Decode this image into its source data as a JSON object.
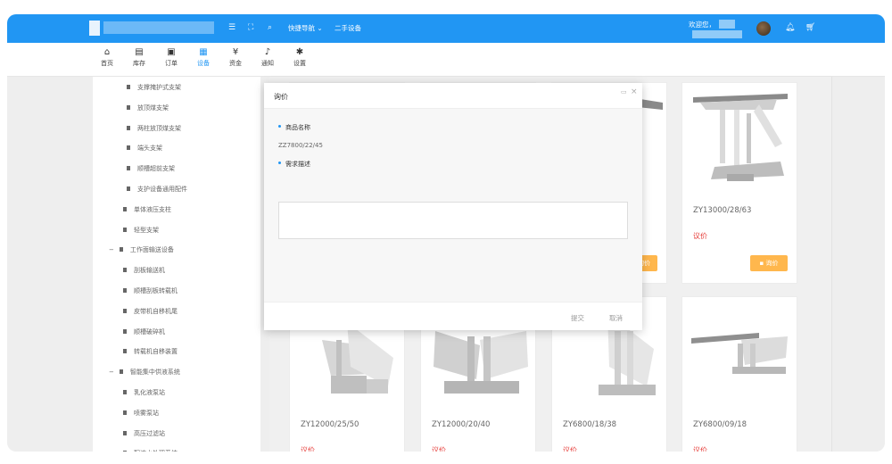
{
  "topbar": {
    "quick_nav": "快捷导航",
    "quick_nav_caret": "⌄",
    "second_hand": "二手设备",
    "welcome": "欢迎您，",
    "icons": [
      "menu-icon",
      "fullscreen-icon",
      "search-icon",
      "bell-icon",
      "cart-icon"
    ],
    "color": "#2196f3"
  },
  "nav": {
    "items": [
      {
        "label": "首页",
        "icon": "home-icon",
        "glyph": "⌂"
      },
      {
        "label": "库存",
        "icon": "inventory-icon",
        "glyph": "▤"
      },
      {
        "label": "订单",
        "icon": "order-icon",
        "glyph": "▣"
      },
      {
        "label": "设备",
        "icon": "equipment-icon",
        "glyph": "▦"
      },
      {
        "label": "资金",
        "icon": "yen-icon",
        "glyph": "¥"
      },
      {
        "label": "通知",
        "icon": "bell-icon",
        "glyph": "♪"
      },
      {
        "label": "设置",
        "icon": "gear-icon",
        "glyph": "✱"
      }
    ],
    "active_index": 3
  },
  "sidebar": {
    "items": [
      {
        "label": "支撑掩护式支架",
        "level": 3
      },
      {
        "label": "放顶煤支架",
        "level": 3
      },
      {
        "label": "两柱放顶煤支架",
        "level": 3
      },
      {
        "label": "端头支架",
        "level": 3
      },
      {
        "label": "顺槽超前支架",
        "level": 3
      },
      {
        "label": "支护设备通用配件",
        "level": 3
      },
      {
        "label": "单体液压支柱",
        "level": 2
      },
      {
        "label": "轻型支架",
        "level": 2
      },
      {
        "label": "工作面输送设备",
        "level": 1,
        "toggle": "−"
      },
      {
        "label": "刮板输送机",
        "level": 2
      },
      {
        "label": "顺槽刮板转载机",
        "level": 2
      },
      {
        "label": "皮带机自移机尾",
        "level": 2
      },
      {
        "label": "顺槽破碎机",
        "level": 2
      },
      {
        "label": "转载机自移装置",
        "level": 2
      },
      {
        "label": "智能集中供液系统",
        "level": 1,
        "toggle": "−"
      },
      {
        "label": "乳化液泵站",
        "level": 2
      },
      {
        "label": "喷雾泵站",
        "level": 2
      },
      {
        "label": "高压过滤站",
        "level": 2
      },
      {
        "label": "配液水处理系统",
        "level": 2
      }
    ]
  },
  "products": {
    "row1": [
      {
        "model": "ZY13000/28/63",
        "price": "议价",
        "ask": "询价"
      }
    ],
    "row1_hidden_ask": "询价",
    "row2": [
      {
        "model": "ZY12000/25/50",
        "price": "议价"
      },
      {
        "model": "ZY12000/20/40",
        "price": "议价"
      },
      {
        "model": "ZY6800/18/38",
        "price": "议价"
      },
      {
        "model": "ZY6800/09/18",
        "price": "议价"
      }
    ],
    "ask_color": "#ffb74d",
    "price_color": "#e53935"
  },
  "modal": {
    "title": "询价",
    "product_name_label": "商品名称",
    "product_name_value": "ZZ7800/22/45",
    "description_label": "需求描述",
    "description_value": "",
    "submit": "提交",
    "cancel": "取消",
    "max_glyph": "▭",
    "close_glyph": "×"
  }
}
